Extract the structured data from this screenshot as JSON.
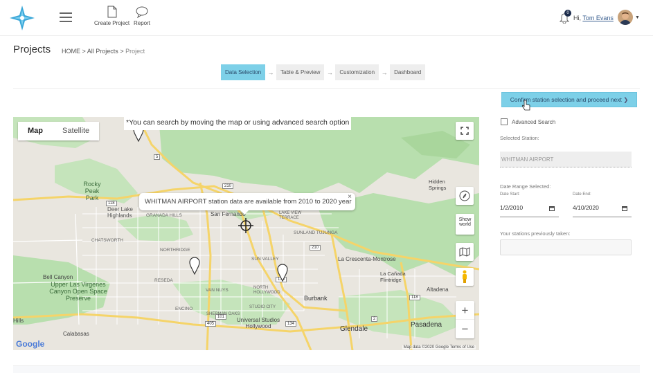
{
  "header": {
    "create_project": "Create Project",
    "report": "Report",
    "notification_count": "0",
    "greeting": "Hi,",
    "user_name": "Tom Evans"
  },
  "page": {
    "title": "Projects",
    "breadcrumb_home": "HOME",
    "breadcrumb_sep1": ">",
    "breadcrumb_all": "All Projects",
    "breadcrumb_sep2": ">",
    "breadcrumb_current": "Project"
  },
  "steps": [
    {
      "label": "Data Selection",
      "active": true
    },
    {
      "label": "Table & Preview",
      "active": false
    },
    {
      "label": "Customization",
      "active": false
    },
    {
      "label": "Dashboard",
      "active": false
    }
  ],
  "step_arrow": "→",
  "confirm_button": "Confirm station selection and proceed next",
  "map": {
    "toggle_map": "Map",
    "toggle_satellite": "Satellite",
    "notice": "*You can search by moving the map or using advanced search option",
    "info": "WHITMAN AIRPORT station data are available from 2010 to 2020 year",
    "info_close": "×",
    "show_world": "Show world",
    "zoom_in": "+",
    "zoom_out": "−",
    "attribution": "Map data ©2020 Google   Terms of Use",
    "google": "Google",
    "places": {
      "rocky_peak": "Rocky Peak Park",
      "deer_lake": "Deer Lake Highlands",
      "chatsworth": "CHATSWORTH",
      "granada_hills": "GRANADA HILLS",
      "san_fernando": "San Fernando",
      "lake_view": "LAKE VIEW TERRACE",
      "northridge": "NORTHRIDGE",
      "sunland": "SUNLAND TUJUNGA",
      "sun_valley": "SUN VALLEY",
      "la_crescenta": "La Crescenta-Montrose",
      "bell_canyon": "Bell Canyon",
      "upper_las_virgenes": "Upper Las Virgenes Canyon Open Space Preserve",
      "reseda": "RESEDA",
      "van_nuys": "VAN NUYS",
      "north_hollywood": "NORTH HOLLYWOOD",
      "burbank": "Burbank",
      "la_canada": "La Cañada Flintridge",
      "altadena": "Altadena",
      "hidden_hills": "Hills",
      "calabasas": "Calabasas",
      "universal": "Universal Studios Hollywood",
      "glendale": "Glendale",
      "pasadena": "Pasadena",
      "hidden_springs": "Hidden Springs",
      "encino": "ENCINO",
      "sherman_oaks": "SHERMAN OAKS",
      "studio_city": "STUDIO CITY"
    },
    "highways": [
      "5",
      "210",
      "405",
      "118",
      "170",
      "101",
      "134",
      "2",
      "210",
      "118"
    ]
  },
  "panel": {
    "advanced_search": "Advanced Search",
    "selected_station_label": "Selected Station:",
    "selected_station_value": "WHITMAN AIRPORT",
    "date_range_label": "Date Range Selected:",
    "date_start_label": "Date Start:",
    "date_end_label": "Date End:",
    "date_start": "1/2/2010",
    "date_end": "4/10/2020",
    "previous_label": "Your stations previously taken:"
  },
  "colors": {
    "accent": "#7dd0e8",
    "park_green": "#b8dfae",
    "highway_yellow": "#f5d469"
  }
}
